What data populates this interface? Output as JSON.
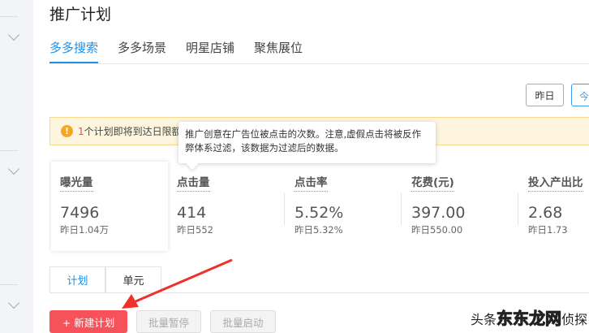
{
  "page": {
    "title": "推广计划"
  },
  "tabs": [
    "多多搜索",
    "多多场景",
    "明星店铺",
    "聚焦展位"
  ],
  "date_buttons": {
    "yesterday": "昨日",
    "today": "今"
  },
  "alert": {
    "count": "1",
    "text": "个计划即将到达日限额"
  },
  "tooltip": "推广创意在广告位被点击的次数。注意,虚假点击将被反作弊体系过滤，该数据为过滤后的数据。",
  "metrics": [
    {
      "label": "曝光量",
      "value": "7496",
      "prev": "昨日1.04万"
    },
    {
      "label": "点击量",
      "value": "414",
      "prev": "昨日552"
    },
    {
      "label": "点击率",
      "value": "5.52%",
      "prev": "昨日5.32%"
    },
    {
      "label": "花费(元)",
      "value": "397.00",
      "prev": "昨日550.00"
    },
    {
      "label": "投入产出比",
      "value": "2.68",
      "prev": "昨日1.73"
    }
  ],
  "subtabs": [
    "计划",
    "单元"
  ],
  "actions": {
    "new": "+ 新建计划",
    "pause": "批量暂停",
    "start": "批量启动"
  },
  "watermark": {
    "prefix": "头条",
    "brand": "东东龙网",
    "suffix": "侦探"
  },
  "colors": {
    "accent": "#1e90e8",
    "danger": "#f5525a",
    "warning": "#f5a623"
  }
}
